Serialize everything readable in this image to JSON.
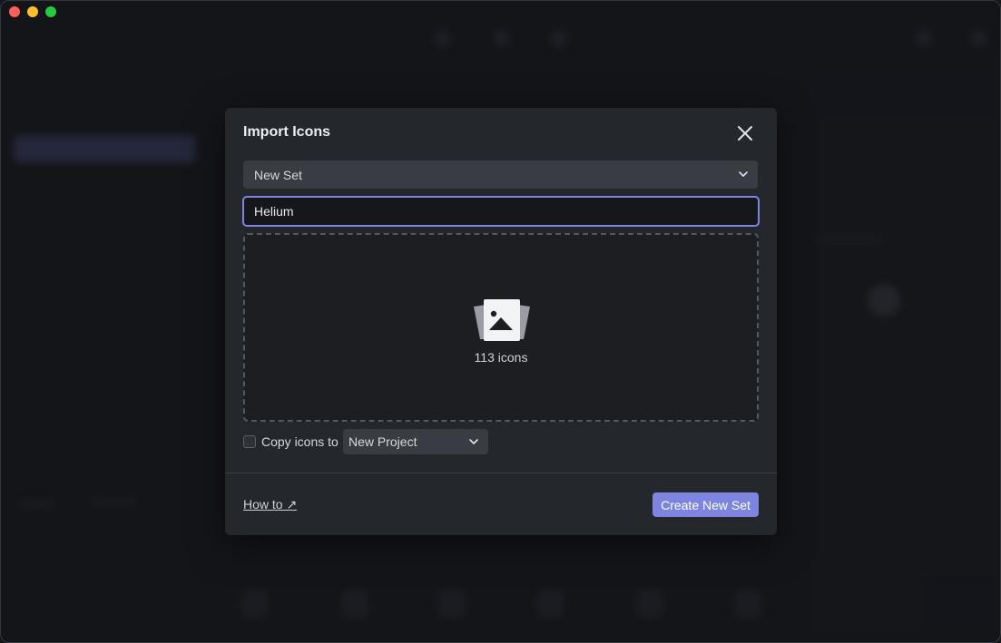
{
  "window": {
    "controls": [
      "close",
      "minimize",
      "zoom"
    ]
  },
  "dialog": {
    "title": "Import Icons",
    "set_select": {
      "value": "New Set",
      "icon": "chevron-down-icon"
    },
    "name_input": {
      "value": "Helium"
    },
    "dropzone": {
      "icon": "image-stack-icon",
      "count_label": "113 icons"
    },
    "copy_option": {
      "checked": false,
      "label": "Copy icons to",
      "project_value": "New Project"
    },
    "footer": {
      "howto_label": "How to ↗",
      "create_label": "Create New Set"
    }
  },
  "colors": {
    "accent": "#7d85e0",
    "dialog_bg": "#24272c",
    "window_bg": "#17191d"
  }
}
